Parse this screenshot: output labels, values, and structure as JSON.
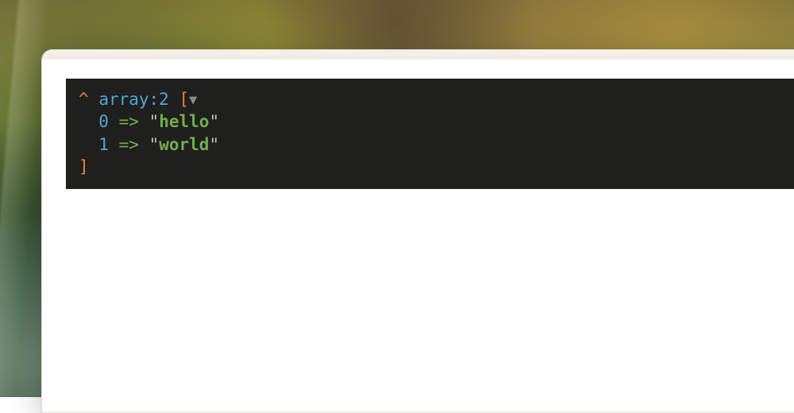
{
  "dump": {
    "caret": "^",
    "type_label": "array:2",
    "open_bracket": "[",
    "collapse_glyph": "▼",
    "close_bracket": "]",
    "arrow": "=>",
    "quote": "\"",
    "entries": [
      {
        "key": "0",
        "value": "hello"
      },
      {
        "key": "1",
        "value": "world"
      }
    ]
  }
}
